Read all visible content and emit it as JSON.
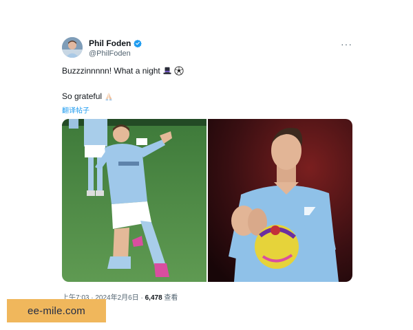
{
  "tweet": {
    "author": {
      "display_name": "Phil Foden",
      "handle": "@PhilFoden",
      "verified_icon": "verified-badge-icon"
    },
    "more_label": "···",
    "text_line1": "Buzzzinnnnn! What a night",
    "text_line1_emojis": [
      "top-hat-icon",
      "soccer-ball-icon"
    ],
    "text_line2": "So grateful",
    "text_line2_emoji": "praying-hands-icon",
    "translate_label": "翻译帖子",
    "media": [
      {
        "description_icon": "celebration-photo"
      },
      {
        "description_icon": "applause-photo"
      }
    ],
    "meta": {
      "timestamp": "上午7:03 · 2024年2月6日 · ",
      "views": "6,478",
      "views_label": " 查看"
    }
  },
  "watermark": {
    "text": "ee-mile.com"
  },
  "colors": {
    "link": "#1d9bf0",
    "secondary_text": "#536471",
    "watermark_bg": "#f0b75c",
    "kit_sky_blue": "#8fc1e8"
  }
}
